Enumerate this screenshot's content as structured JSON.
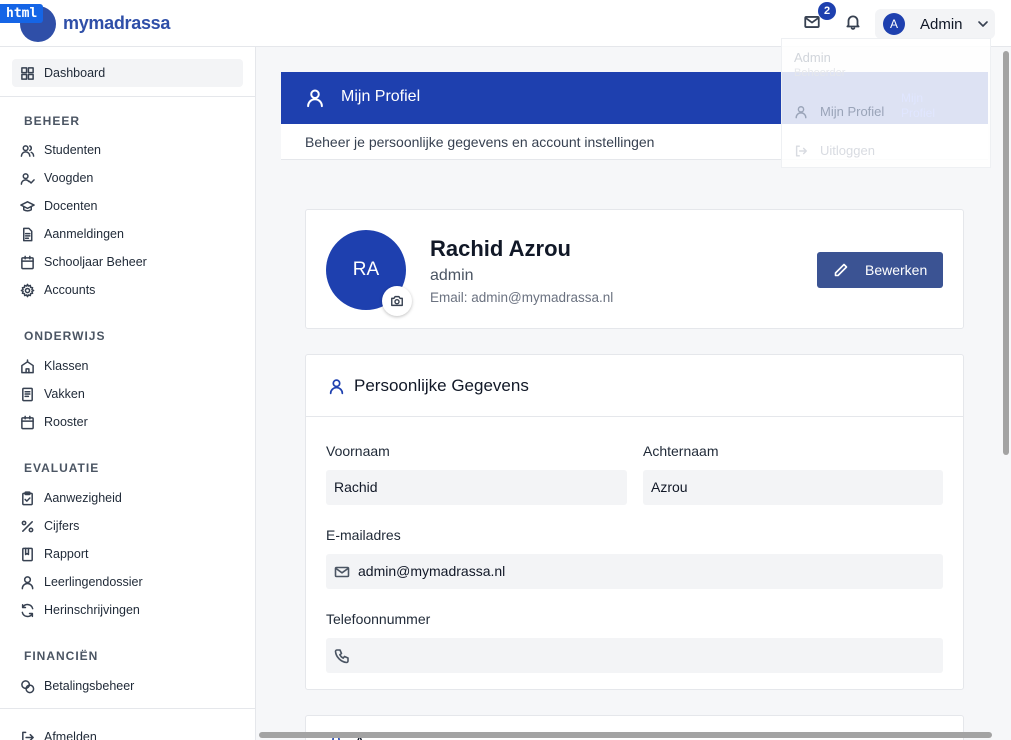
{
  "header": {
    "debug_tag": "html",
    "logo_part1": "my",
    "logo_part2": "madrassa",
    "mail_count": "2",
    "user_initial": "A",
    "user_name": "Admin"
  },
  "sidebar": {
    "dashboard": "Dashboard",
    "sections": {
      "beheer": "BEHEER",
      "onderwijs": "ONDERWIJS",
      "evaluatie": "EVALUATIE",
      "financien": "FINANCIËN"
    },
    "items": {
      "studenten": "Studenten",
      "voogden": "Voogden",
      "docenten": "Docenten",
      "aanmeldingen": "Aanmeldingen",
      "schooljaar": "Schooljaar Beheer",
      "accounts": "Accounts",
      "klassen": "Klassen",
      "vakken": "Vakken",
      "rooster": "Rooster",
      "aanwezigheid": "Aanwezigheid",
      "cijfers": "Cijfers",
      "rapport": "Rapport",
      "leerlingendossier": "Leerlingendossier",
      "herinschrijvingen": "Herinschrijvingen",
      "betalingsbeheer": "Betalingsbeheer",
      "afmelden": "Afmelden"
    }
  },
  "page": {
    "title": "Mijn Profiel",
    "subtitle": "Beheer je persoonlijke gegevens en account instellingen"
  },
  "profile": {
    "initials": "RA",
    "name": "Rachid Azrou",
    "role": "admin",
    "email_line": "Email: admin@mymadrassa.nl",
    "edit_label": "Bewerken"
  },
  "personal": {
    "title": "Persoonlijke Gegevens",
    "first_name_label": "Voornaam",
    "first_name": "Rachid",
    "last_name_label": "Achternaam",
    "last_name": "Azrou",
    "email_label": "E-mailadres",
    "email": "admin@mymadrassa.nl",
    "phone_label": "Telefoonnummer",
    "phone": ""
  },
  "next_card_title_fragment": "A",
  "dropdown": {
    "name": "Admin",
    "role": "Beheerder",
    "profile": "Mijn Profiel",
    "logout": "Uitloggen",
    "tooltip": "Mijn Profiel"
  }
}
